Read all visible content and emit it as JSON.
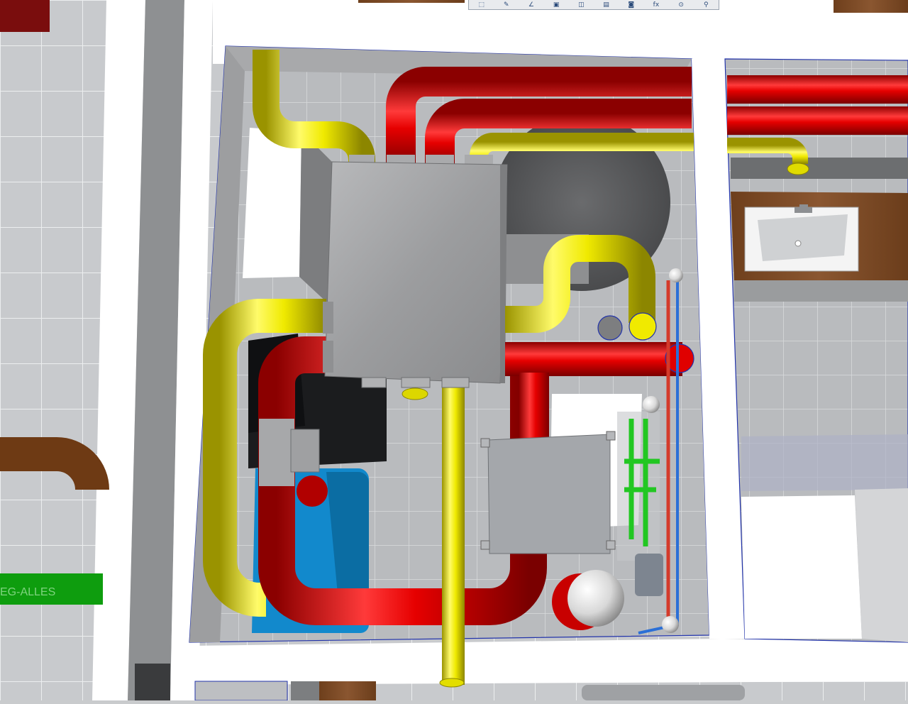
{
  "viewport": {
    "pipe_label": "EG-ALLES"
  },
  "toolbar": {
    "buttons": [
      {
        "icon": "select-icon",
        "glyph": "⬚"
      },
      {
        "icon": "sketch-icon",
        "glyph": "✎"
      },
      {
        "icon": "line-icon",
        "glyph": "∠"
      },
      {
        "icon": "render-icon",
        "glyph": "▣"
      },
      {
        "icon": "view-icon",
        "glyph": "◫"
      },
      {
        "icon": "section-icon",
        "glyph": "▤"
      },
      {
        "icon": "camera-icon",
        "glyph": "◙"
      },
      {
        "icon": "formula-icon",
        "glyph": "fx"
      },
      {
        "icon": "measure-icon",
        "glyph": "⊙"
      },
      {
        "icon": "probe-icon",
        "glyph": "⚲"
      }
    ]
  },
  "colors": {
    "supply_pipe": "#e00000",
    "exhaust_pipe": "#f2ee00",
    "pipe_green": "#1aa51a",
    "pipe_brown": "#7a3d12",
    "unit_gray": "#9d9fa2",
    "tank_blue": "#1488c9",
    "wood": "#7a4a24",
    "floor_tile": "#c7c9cc"
  }
}
